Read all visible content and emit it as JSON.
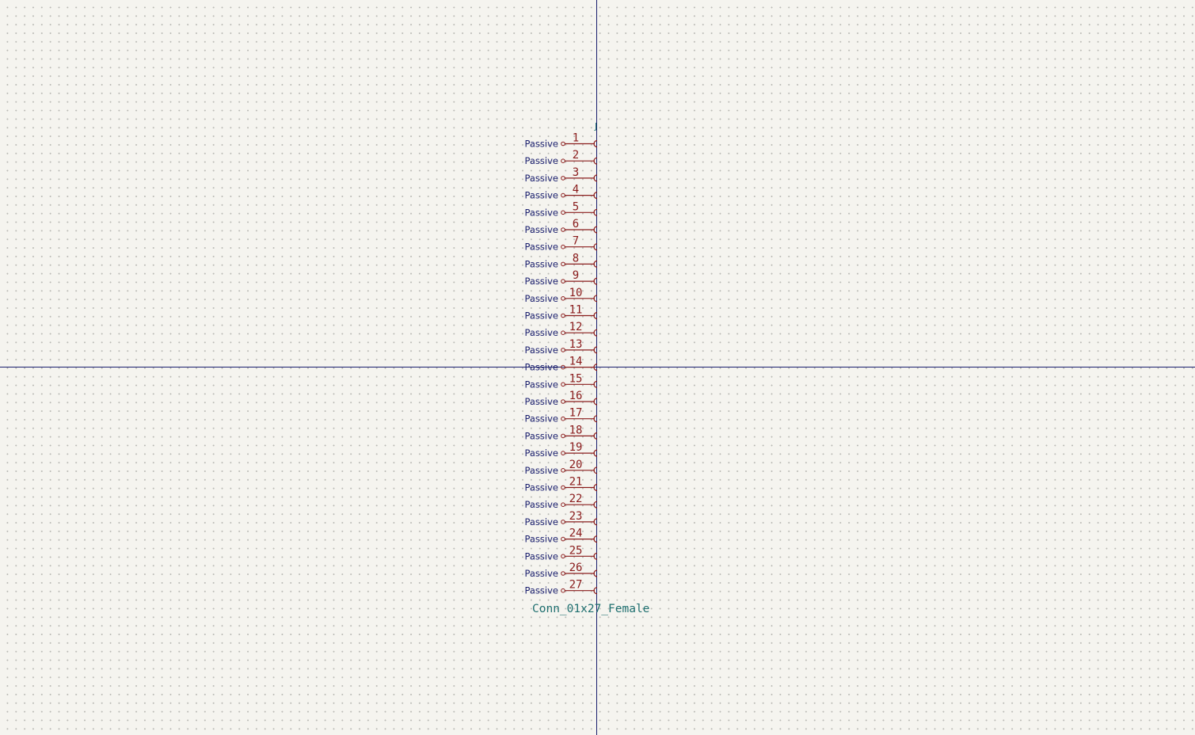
{
  "symbol": {
    "reference": "J",
    "value": "Conn_01x27_Female",
    "pins": [
      {
        "number": "1",
        "type": "Passive"
      },
      {
        "number": "2",
        "type": "Passive"
      },
      {
        "number": "3",
        "type": "Passive"
      },
      {
        "number": "4",
        "type": "Passive"
      },
      {
        "number": "5",
        "type": "Passive"
      },
      {
        "number": "6",
        "type": "Passive"
      },
      {
        "number": "7",
        "type": "Passive"
      },
      {
        "number": "8",
        "type": "Passive"
      },
      {
        "number": "9",
        "type": "Passive"
      },
      {
        "number": "10",
        "type": "Passive"
      },
      {
        "number": "11",
        "type": "Passive"
      },
      {
        "number": "12",
        "type": "Passive"
      },
      {
        "number": "13",
        "type": "Passive"
      },
      {
        "number": "14",
        "type": "Passive"
      },
      {
        "number": "15",
        "type": "Passive"
      },
      {
        "number": "16",
        "type": "Passive"
      },
      {
        "number": "17",
        "type": "Passive"
      },
      {
        "number": "18",
        "type": "Passive"
      },
      {
        "number": "19",
        "type": "Passive"
      },
      {
        "number": "20",
        "type": "Passive"
      },
      {
        "number": "21",
        "type": "Passive"
      },
      {
        "number": "22",
        "type": "Passive"
      },
      {
        "number": "23",
        "type": "Passive"
      },
      {
        "number": "24",
        "type": "Passive"
      },
      {
        "number": "25",
        "type": "Passive"
      },
      {
        "number": "26",
        "type": "Passive"
      },
      {
        "number": "27",
        "type": "Passive"
      }
    ]
  },
  "colors": {
    "background": "#f5f4ef",
    "axis": "#1a1f6e",
    "pin": "#8a1c1c",
    "pin_type_text": "#1a1f6e",
    "field_text": "#1f6f6f"
  }
}
